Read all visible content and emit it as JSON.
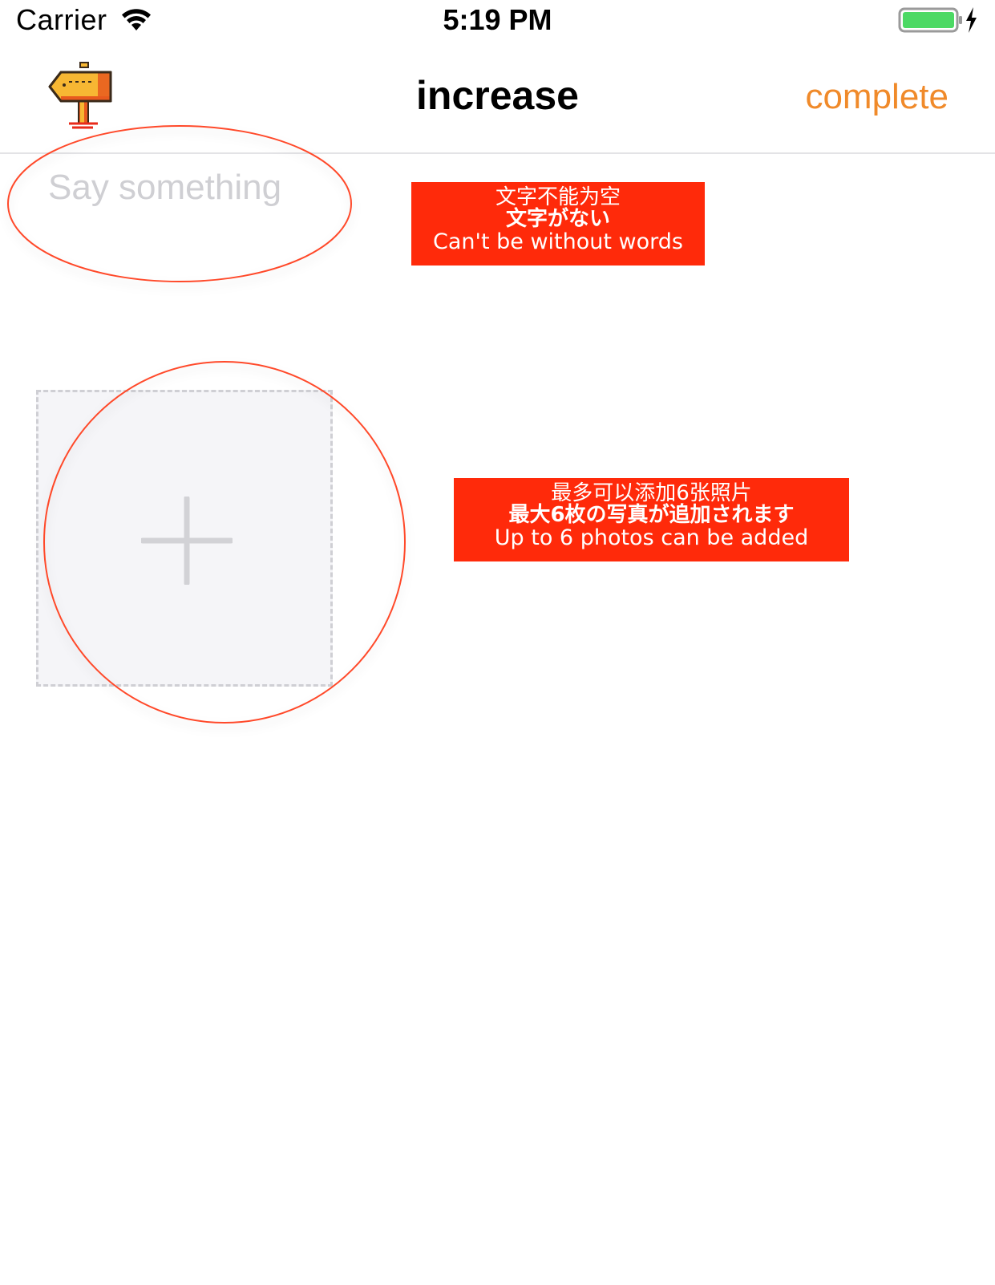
{
  "status_bar": {
    "carrier": "Carrier",
    "time": "5:19 PM",
    "wifi_icon": "wifi-icon",
    "battery_icon": "battery-charging-icon",
    "battery_color": "#4cd964"
  },
  "nav": {
    "back_icon": "signpost-icon",
    "title": "increase",
    "complete_label": "complete",
    "accent_color": "#f08a2a"
  },
  "compose": {
    "placeholder": "Say something",
    "value": ""
  },
  "photos": {
    "add_icon": "plus-icon"
  },
  "annotations": {
    "text_required": {
      "zh": "文字不能为空",
      "ja": "文字がない",
      "en": "Can't be without words"
    },
    "photo_limit": {
      "zh": "最多可以添加6张照片",
      "ja": "最大6枚の写真が追加されます",
      "en": "Up to 6 photos can be added"
    },
    "annotation_color": "#ff2a0a"
  }
}
